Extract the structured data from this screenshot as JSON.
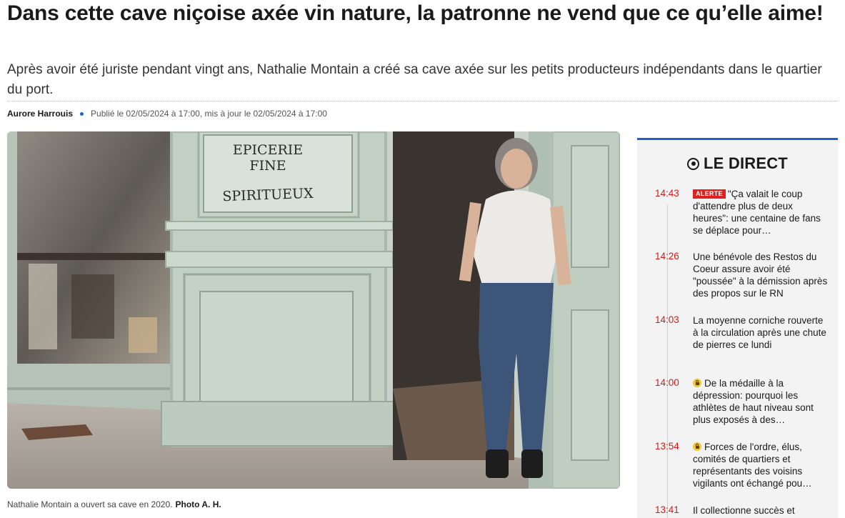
{
  "article": {
    "headline": "Dans cette cave niçoise axée vin nature, la patronne ne vend que ce qu’elle aime!",
    "subtitle": "Après avoir été juriste pendant vingt ans, Nathalie Montain a créé sa cave axée sur les petits producteurs indépendants dans le quartier du port.",
    "author": "Aurore Harrouis",
    "published": "Publié le 02/05/2024 à 17:00, mis à jour le 02/05/2024 à 17:00",
    "photo_sign_line1": "EPICERIE",
    "photo_sign_line2": "FINE",
    "photo_sign_line3": "SPIRITUEUX",
    "caption": "Nathalie Montain a ouvert sa cave en 2020.",
    "caption_credit": "Photo A. H."
  },
  "direct": {
    "title": "LE DIRECT",
    "icon": "live-icon",
    "alert_label": "ALERTE",
    "items": [
      {
        "time": "14:43",
        "text": "\"Ça valait le coup d'attendre plus de deux heures\": une centaine de fans se déplace pour…"
      },
      {
        "time": "14:26",
        "text": "Une bénévole des Restos du Coeur assure avoir été \"poussée\" à la démission après des propos sur le RN"
      },
      {
        "time": "14:03",
        "text": "La moyenne corniche rouverte à la circulation après une chute de pierres ce lundi"
      },
      {
        "time": "14:00",
        "text": "De la médaille à la dépression: pourquoi les athlètes de haut niveau sont plus exposés à des…"
      },
      {
        "time": "13:54",
        "text": "Forces de l'ordre, élus, comités de quartiers et représentants des voisins vigilants ont échangé pou…"
      },
      {
        "time": "13:41",
        "text": "Il collectionne succès et polémiques: qui est Cédric"
      }
    ]
  },
  "colors": {
    "accent_blue": "#1b5fd0",
    "time_red": "#d61a1a",
    "alert_red": "#e32020",
    "premium_yellow": "#f4c430"
  }
}
